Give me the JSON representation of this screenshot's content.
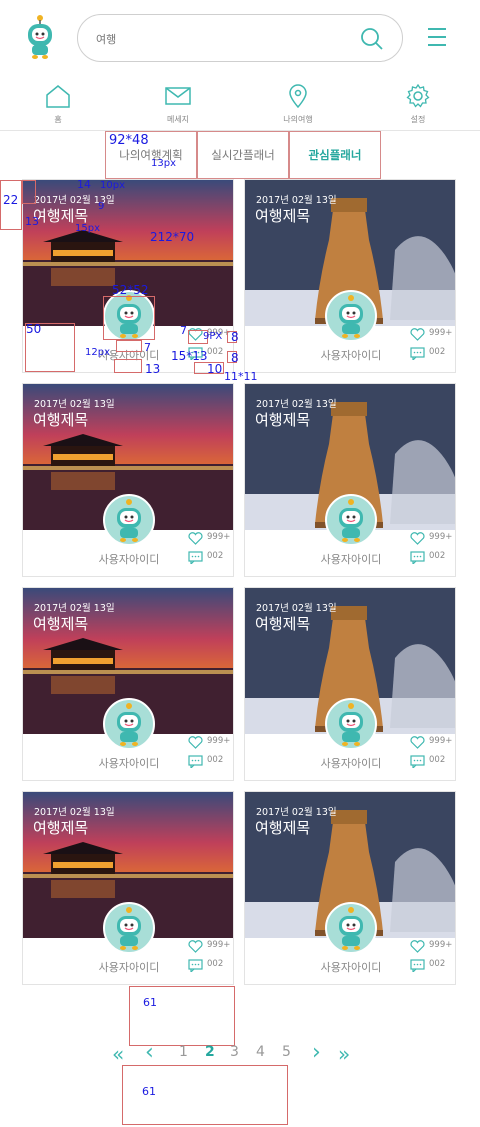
{
  "header": {
    "search_placeholder": "여행"
  },
  "nav": [
    {
      "label": "홈",
      "icon": "home-icon"
    },
    {
      "label": "메세지",
      "icon": "mail-icon"
    },
    {
      "label": "나의여행",
      "icon": "location-pin-icon"
    },
    {
      "label": "설정",
      "icon": "gear-icon"
    }
  ],
  "tabs": [
    {
      "label": "나의여행계획",
      "active": false
    },
    {
      "label": "실시간플래너",
      "active": false
    },
    {
      "label": "관심플래너",
      "active": true
    }
  ],
  "cards": [
    {
      "date": "2017년 02월 13일",
      "title": "여행제목",
      "user": "사용자아이디",
      "likes": "999+",
      "comments": "002",
      "photo": "pavilion"
    },
    {
      "date": "2017년 02월 13일",
      "title": "여행제목",
      "user": "사용자아이디",
      "likes": "999+",
      "comments": "002",
      "photo": "tower"
    },
    {
      "date": "2017년 02월 13일",
      "title": "여행제목",
      "user": "사용자아이디",
      "likes": "999+",
      "comments": "002",
      "photo": "pavilion"
    },
    {
      "date": "2017년 02월 13일",
      "title": "여행제목",
      "user": "사용자아이디",
      "likes": "999+",
      "comments": "002",
      "photo": "tower"
    },
    {
      "date": "2017년 02월 13일",
      "title": "여행제목",
      "user": "사용자아이디",
      "likes": "999+",
      "comments": "002",
      "photo": "pavilion"
    },
    {
      "date": "2017년 02월 13일",
      "title": "여행제목",
      "user": "사용자아이디",
      "likes": "999+",
      "comments": "002",
      "photo": "tower"
    },
    {
      "date": "2017년 02월 13일",
      "title": "여행제목",
      "user": "사용자아이디",
      "likes": "999+",
      "comments": "002",
      "photo": "pavilion"
    },
    {
      "date": "2017년 02월 13일",
      "title": "여행제목",
      "user": "사용자아이디",
      "likes": "999+",
      "comments": "002",
      "photo": "tower"
    }
  ],
  "pagination": {
    "first": "«",
    "prev": "‹",
    "pages": [
      "1",
      "2",
      "3",
      "4",
      "5"
    ],
    "current": "2",
    "next": "›",
    "last": "»"
  },
  "annotations": {
    "tab_size": "92*48",
    "tab_font": "13px",
    "left_margin": "22",
    "top_13": "13",
    "date_size": "14",
    "date_font": "10px",
    "gap_9": "9",
    "title_font": "15px",
    "photo_size": "212*70",
    "avatar_size": "52*52",
    "bottom_50": "50",
    "gap_7a": "7",
    "user_font": "12px",
    "gap_7b": "7",
    "gap_13": "13",
    "count_font": "9PX",
    "icon_15": "15*13",
    "gap_8a": "8",
    "gap_8b": "8",
    "gap_10": "10",
    "icon_11": "11*11",
    "spacing_61a": "61",
    "spacing_61b": "61"
  },
  "colors": {
    "accent": "#25a79e",
    "annotation_box": "#d56a6a",
    "annotation_text": "#1a1ae0"
  }
}
